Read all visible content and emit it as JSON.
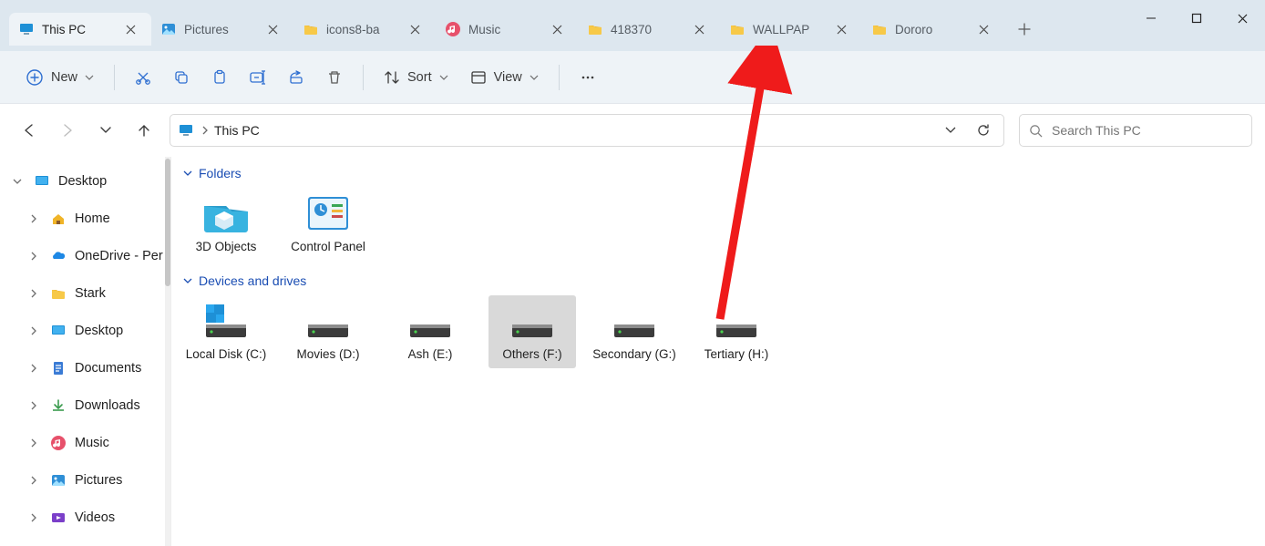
{
  "tabs": [
    {
      "label": "This PC",
      "icon": "monitor",
      "active": true
    },
    {
      "label": "Pictures",
      "icon": "picture",
      "active": false
    },
    {
      "label": "icons8-ba",
      "icon": "folder",
      "active": false
    },
    {
      "label": "Music",
      "icon": "music",
      "active": false
    },
    {
      "label": "418370",
      "icon": "folder",
      "active": false
    },
    {
      "label": "WALLPAP",
      "icon": "folder",
      "active": false
    },
    {
      "label": "Dororo",
      "icon": "folder",
      "active": false
    }
  ],
  "toolbar": {
    "new_label": "New",
    "sort_label": "Sort",
    "view_label": "View"
  },
  "address": {
    "crumb": "This PC"
  },
  "search": {
    "placeholder": "Search This PC"
  },
  "sidebar": [
    {
      "label": "Desktop",
      "icon": "desktop-blue",
      "level": 0,
      "expanded": true
    },
    {
      "label": "Home",
      "icon": "home",
      "level": 1,
      "expanded": false
    },
    {
      "label": "OneDrive - Per",
      "icon": "onedrive",
      "level": 1,
      "expanded": false
    },
    {
      "label": "Stark",
      "icon": "folder",
      "level": 1,
      "expanded": false
    },
    {
      "label": "Desktop",
      "icon": "desktop-blue",
      "level": 1,
      "expanded": false
    },
    {
      "label": "Documents",
      "icon": "documents",
      "level": 1,
      "expanded": false
    },
    {
      "label": "Downloads",
      "icon": "downloads",
      "level": 1,
      "expanded": false
    },
    {
      "label": "Music",
      "icon": "music",
      "level": 1,
      "expanded": false
    },
    {
      "label": "Pictures",
      "icon": "picture",
      "level": 1,
      "expanded": false
    },
    {
      "label": "Videos",
      "icon": "videos",
      "level": 1,
      "expanded": false
    }
  ],
  "groups": {
    "folders_label": "Folders",
    "devices_label": "Devices and drives"
  },
  "folders": [
    {
      "label": "3D Objects",
      "icon": "3d"
    },
    {
      "label": "Control Panel",
      "icon": "ctrlpanel"
    }
  ],
  "drives": [
    {
      "label": "Local Disk (C:)",
      "icon": "drive-win"
    },
    {
      "label": "Movies (D:)",
      "icon": "drive"
    },
    {
      "label": "Ash (E:)",
      "icon": "drive"
    },
    {
      "label": "Others (F:)",
      "icon": "drive",
      "selected": true
    },
    {
      "label": "Secondary (G:)",
      "icon": "drive"
    },
    {
      "label": "Tertiary (H:)",
      "icon": "drive"
    }
  ]
}
